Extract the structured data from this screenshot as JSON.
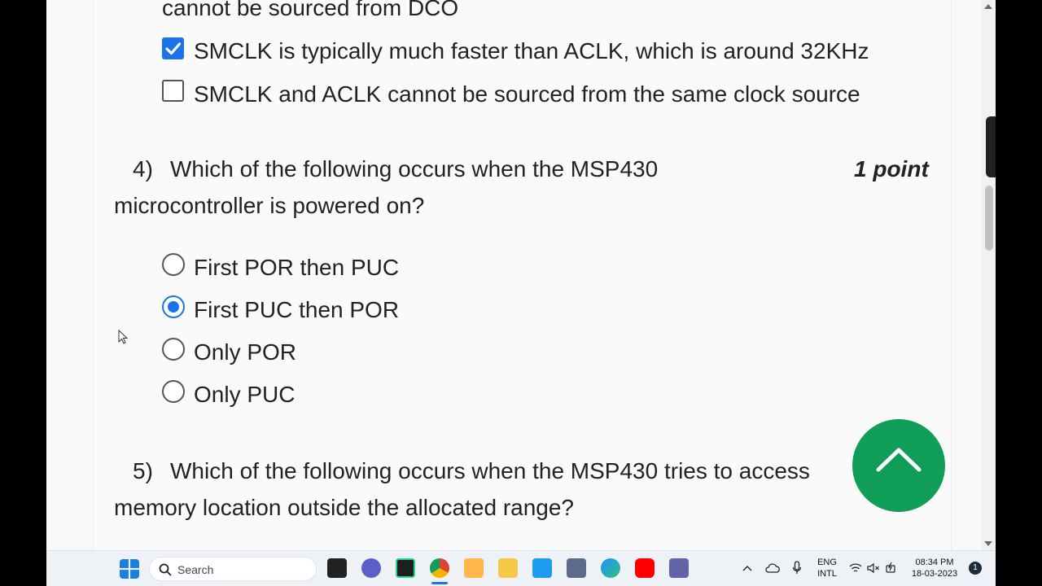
{
  "question3_tail": {
    "fragment": "cannot be sourced from DCO",
    "options": [
      {
        "label": "SMCLK is typically much faster than ACLK, which is around 32KHz",
        "checked": true
      },
      {
        "label": "SMCLK and ACLK cannot be sourced from the same clock source",
        "checked": false
      }
    ]
  },
  "question4": {
    "number": "4)",
    "text_line1": "Which of the following occurs when the MSP430",
    "text_line2": "microcontroller is powered on?",
    "points": "1 point",
    "options": [
      {
        "label": "First POR then PUC",
        "selected": false
      },
      {
        "label": "First PUC then POR",
        "selected": true
      },
      {
        "label": "Only POR",
        "selected": false
      },
      {
        "label": "Only PUC",
        "selected": false
      }
    ]
  },
  "question5": {
    "number": "5)",
    "text_line1": "Which of the following occurs when the MSP430 tries to access",
    "text_line2": "memory location outside the allocated range?"
  },
  "fab": {
    "icon": "chevron-up-icon",
    "color": "#0f9d58"
  },
  "accent_color": "#1a73e8",
  "taskbar": {
    "search_placeholder": "Search",
    "apps": [
      "windows-start-icon",
      "file-explorer-dark-icon",
      "chat-icon",
      "pycharm-icon",
      "chrome-icon",
      "media-player-icon",
      "folder-icon",
      "twitter-icon",
      "calculator-icon",
      "edge-icon",
      "youtube-icon",
      "teams-icon"
    ],
    "tray": {
      "lang_line1": "ENG",
      "lang_line2": "INTL",
      "time": "08:34 PM",
      "date": "18-03-2023",
      "notification_count": "1"
    }
  }
}
